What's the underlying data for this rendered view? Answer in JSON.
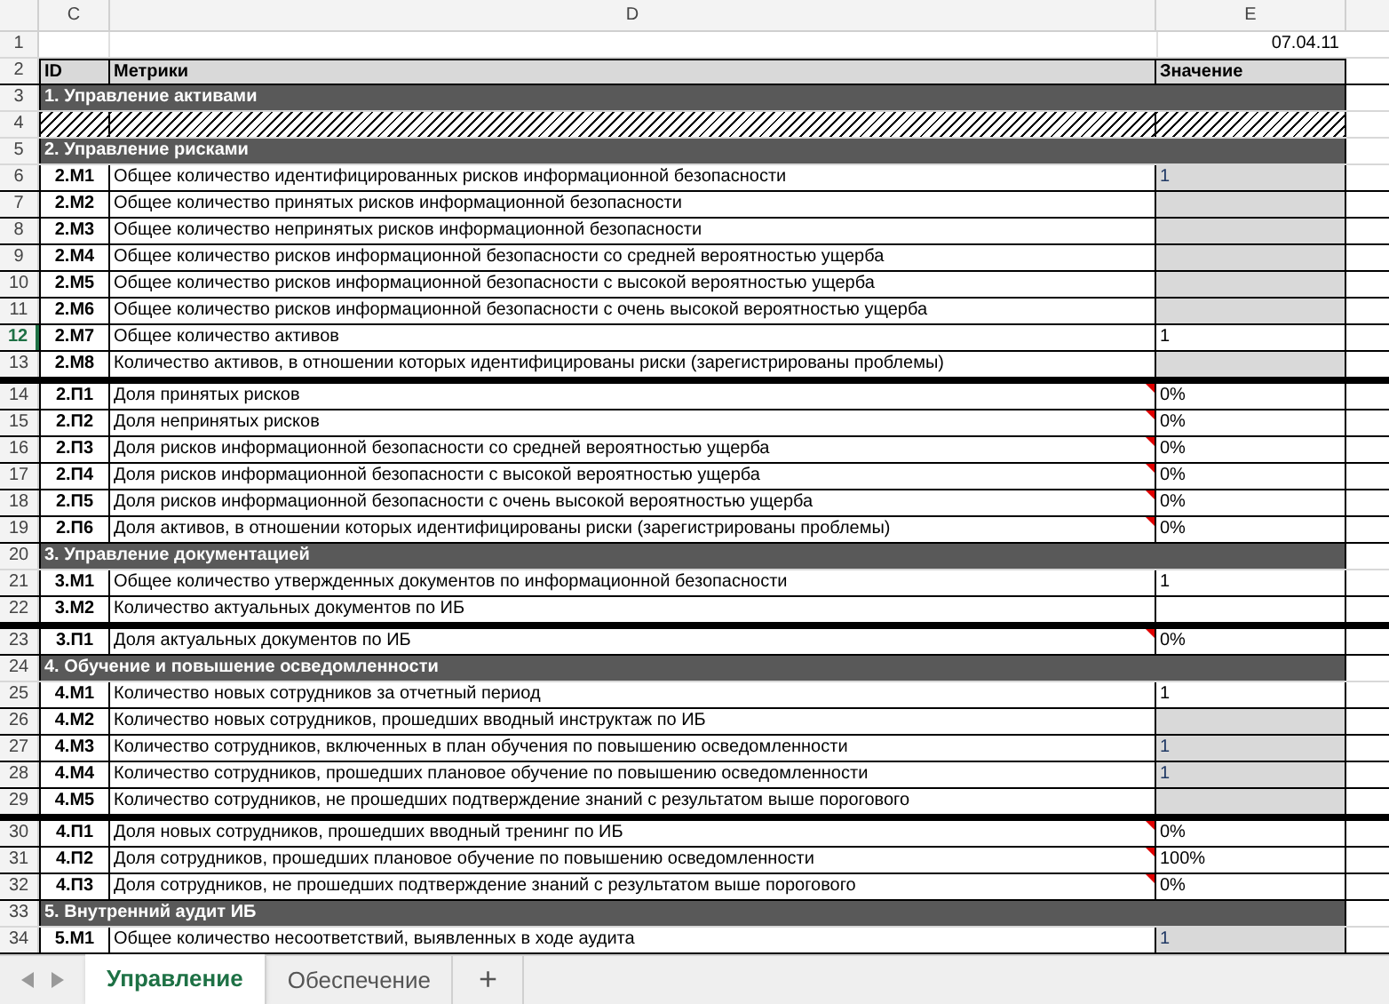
{
  "columns": [
    "C",
    "D",
    "E"
  ],
  "rows": [
    {
      "kind": "blank",
      "number": "1",
      "selected": false,
      "value": "07.04.11"
    },
    {
      "kind": "header",
      "number": "2",
      "selected": false,
      "id": "ID",
      "metric": "Метрики",
      "value": "Значение"
    },
    {
      "kind": "section",
      "number": "3",
      "selected": false,
      "title": "1. Управление активами"
    },
    {
      "kind": "hatched",
      "number": "4",
      "selected": false
    },
    {
      "kind": "section",
      "number": "5",
      "selected": false,
      "title": "2. Управление рисками"
    },
    {
      "kind": "metric",
      "number": "6",
      "selected": false,
      "id": "2.М1",
      "metric": "Общее количество идентифицированных рисков информационной безопасности",
      "value": "1",
      "input": true,
      "comment": false,
      "separator": false
    },
    {
      "kind": "metric",
      "number": "7",
      "selected": false,
      "id": "2.М2",
      "metric": "Общее количество принятых рисков  информационной безопасности",
      "input": true,
      "comment": false,
      "separator": false
    },
    {
      "kind": "metric",
      "number": "8",
      "selected": false,
      "id": "2.М3",
      "metric": "Общее количество непринятых рисков информационной безопасности",
      "input": true,
      "comment": false,
      "separator": false
    },
    {
      "kind": "metric",
      "number": "9",
      "selected": false,
      "id": "2.М4",
      "metric": "Общее количество рисков информационной безопасности со средней вероятностью ущерба",
      "input": true,
      "comment": false,
      "separator": false
    },
    {
      "kind": "metric",
      "number": "10",
      "selected": false,
      "id": "2.М5",
      "metric": "Общее количество рисков информационной безопасности с высокой вероятностью ущерба",
      "input": true,
      "comment": false,
      "separator": false
    },
    {
      "kind": "metric",
      "number": "11",
      "selected": false,
      "id": "2.М6",
      "metric": "Общее количество рисков информационной безопасности с очень высокой вероятностью ущерба",
      "input": true,
      "comment": false,
      "separator": false
    },
    {
      "kind": "metric",
      "number": "12",
      "selected": true,
      "id": "2.М7",
      "metric": "Общее количество активов",
      "value": "1",
      "input": false,
      "comment": false,
      "separator": false
    },
    {
      "kind": "metric",
      "number": "13",
      "selected": false,
      "id": "2.М8",
      "metric": "Количество активов, в отношении которых идентифицированы риски (зарегистрированы проблемы)",
      "input": true,
      "comment": false,
      "separator": false
    },
    {
      "kind": "metric",
      "number": "14",
      "selected": false,
      "id": "2.П1",
      "metric": "Доля принятых рисков",
      "value": "0%",
      "input": false,
      "comment": true,
      "separator": true
    },
    {
      "kind": "metric",
      "number": "15",
      "selected": false,
      "id": "2.П2",
      "metric": "Доля непринятых рисков",
      "value": "0%",
      "input": false,
      "comment": true,
      "separator": false
    },
    {
      "kind": "metric",
      "number": "16",
      "selected": false,
      "id": "2.П3",
      "metric": "Доля рисков информационной безопасности со средней вероятностью ущерба",
      "value": "0%",
      "input": false,
      "comment": true,
      "separator": false
    },
    {
      "kind": "metric",
      "number": "17",
      "selected": false,
      "id": "2.П4",
      "metric": "Доля рисков информационной безопасности с высокой вероятностью ущерба",
      "value": "0%",
      "input": false,
      "comment": true,
      "separator": false
    },
    {
      "kind": "metric",
      "number": "18",
      "selected": false,
      "id": "2.П5",
      "metric": "Доля рисков информационной безопасности с очень высокой вероятностью ущерба",
      "value": "0%",
      "input": false,
      "comment": true,
      "separator": false
    },
    {
      "kind": "metric",
      "number": "19",
      "selected": false,
      "id": "2.П6",
      "metric": "Доля активов, в отношении которых идентифицированы риски (зарегистрированы проблемы)",
      "value": "0%",
      "input": false,
      "comment": true,
      "separator": false
    },
    {
      "kind": "section",
      "number": "20",
      "selected": false,
      "title": "3. Управление документацией"
    },
    {
      "kind": "metric",
      "number": "21",
      "selected": false,
      "id": "3.М1",
      "metric": "Общее количество утвержденных  документов по информационной безопасности",
      "value": "1",
      "input": false,
      "comment": false,
      "separator": false
    },
    {
      "kind": "metric",
      "number": "22",
      "selected": false,
      "id": "3.М2",
      "metric": "Количество актуальных документов по ИБ",
      "input": false,
      "comment": false,
      "separator": false
    },
    {
      "kind": "metric",
      "number": "23",
      "selected": false,
      "id": "3.П1",
      "metric": "Доля актуальных документов по ИБ",
      "value": "0%",
      "input": false,
      "comment": true,
      "separator": true
    },
    {
      "kind": "section",
      "number": "24",
      "selected": false,
      "title": "4. Обучение и повышение осведомленности"
    },
    {
      "kind": "metric",
      "number": "25",
      "selected": false,
      "id": "4.М1",
      "metric": "Количество новых сотрудников за отчетный период",
      "value": "1",
      "input": false,
      "comment": false,
      "separator": false
    },
    {
      "kind": "metric",
      "number": "26",
      "selected": false,
      "id": "4.М2",
      "metric": "Количество новых сотрудников, прошедших вводный инструктаж по ИБ",
      "input": true,
      "comment": false,
      "separator": false
    },
    {
      "kind": "metric",
      "number": "27",
      "selected": false,
      "id": "4.М3",
      "metric": "Количество сотрудников, включенных в план обучения по повышению осведомленности",
      "value": "1",
      "input": true,
      "comment": false,
      "separator": false
    },
    {
      "kind": "metric",
      "number": "28",
      "selected": false,
      "id": "4.М4",
      "metric": "Количество сотрудников, прошедших плановое обучение по повышению осведомленности",
      "value": "1",
      "input": true,
      "comment": false,
      "separator": false
    },
    {
      "kind": "metric",
      "number": "29",
      "selected": false,
      "id": "4.М5",
      "metric": "Количество сотрудников, не прошедших подтверждение знаний с результатом выше порогового",
      "input": true,
      "comment": false,
      "separator": false
    },
    {
      "kind": "metric",
      "number": "30",
      "selected": false,
      "id": "4.П1",
      "metric": "Доля новых сотрудников, прошедших вводный тренинг по ИБ",
      "value": "0%",
      "input": false,
      "comment": true,
      "separator": true
    },
    {
      "kind": "metric",
      "number": "31",
      "selected": false,
      "id": "4.П2",
      "metric": "Доля сотрудников, прошедших плановое обучение по повышению осведомленности",
      "value": "100%",
      "input": false,
      "comment": true,
      "separator": false
    },
    {
      "kind": "metric",
      "number": "32",
      "selected": false,
      "id": "4.П3",
      "metric": "Доля сотрудников, не прошедших подтверждение знаний с результатом выше порогового",
      "value": "0%",
      "input": false,
      "comment": true,
      "separator": false
    },
    {
      "kind": "section",
      "number": "33",
      "selected": false,
      "title": "5. Внутренний аудит ИБ"
    },
    {
      "kind": "metric",
      "number": "34",
      "selected": false,
      "id": "5.М1",
      "metric": "Общее количество несоответствий, выявленных в ходе аудита",
      "value": "1",
      "input": true,
      "comment": false,
      "separator": false
    }
  ],
  "sheet_tabs": [
    {
      "label": "Управление",
      "selected": true
    },
    {
      "label": "Обеспечение",
      "selected": false
    }
  ],
  "add_sheet": "+"
}
